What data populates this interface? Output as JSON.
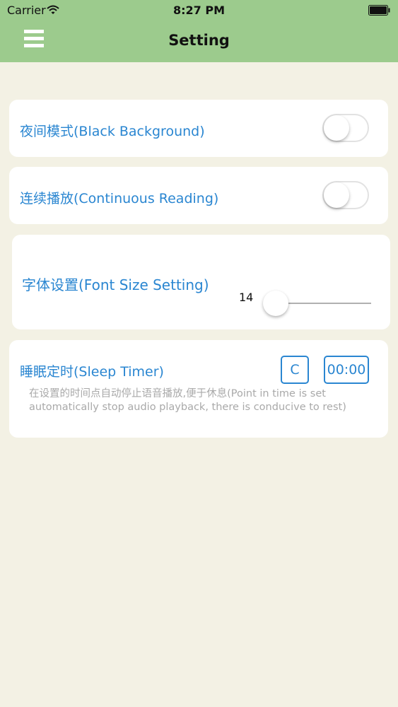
{
  "status_bar": {
    "carrier": "Carrier",
    "time": "8:27 PM"
  },
  "nav": {
    "title": "Setting"
  },
  "settings": {
    "night_mode": {
      "label": "夜间模式(Black Background)",
      "enabled": false
    },
    "continuous_reading": {
      "label": "连续播放(Continuous Reading)",
      "enabled": false
    },
    "font_size": {
      "label": "字体设置(Font Size Setting)",
      "value": "14",
      "slider_fraction": 0
    },
    "sleep_timer": {
      "label": "睡眠定时(Sleep Timer)",
      "clear_label": "C",
      "time_value": "00:00",
      "description": "在设置的时间点自动停止语音播放,便于休息(Point in time is set automatically stop audio playback, there is conducive to rest)"
    }
  },
  "colors": {
    "header": "#9ccb8d",
    "background": "#f3f1e4",
    "accent": "#2a86d1"
  }
}
